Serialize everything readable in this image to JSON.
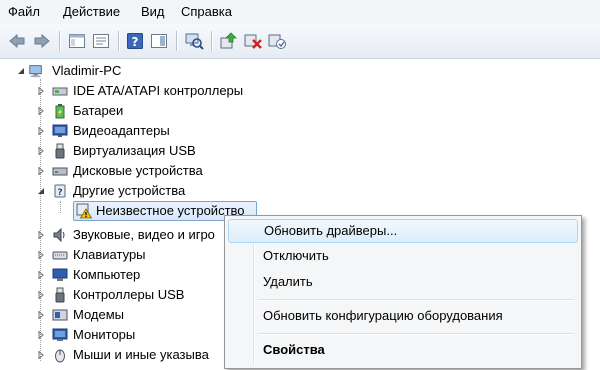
{
  "menubar": {
    "items": [
      "Файл",
      "Действие",
      "Вид",
      "Справка"
    ]
  },
  "toolbar": {
    "buttons": [
      "back-arrow-icon",
      "forward-arrow-icon",
      "show-hide-console-tree-icon",
      "properties-icon",
      "help-icon",
      "show-action-pane-icon",
      "scan-hardware-icon",
      "update-driver-icon",
      "uninstall-device-icon",
      "disable-device-icon"
    ]
  },
  "tree": {
    "root": "Vladimir-PC",
    "items": [
      {
        "label": "IDE ATA/ATAPI контроллеры",
        "icon": "ide-controller-icon"
      },
      {
        "label": "Батареи",
        "icon": "battery-icon"
      },
      {
        "label": "Видеоадаптеры",
        "icon": "display-adapter-icon"
      },
      {
        "label": "Виртуализация USB",
        "icon": "usb-virtualization-icon"
      },
      {
        "label": "Дисковые устройства",
        "icon": "disk-drive-icon"
      },
      {
        "label": "Другие устройства",
        "icon": "other-devices-icon"
      },
      {
        "label": "Неизвестное устройство",
        "icon": "unknown-device-warning-icon"
      },
      {
        "label": "Звуковые, видео и игро",
        "icon": "sound-icon"
      },
      {
        "label": "Клавиатуры",
        "icon": "keyboard-icon"
      },
      {
        "label": "Компьютер",
        "icon": "computer-icon"
      },
      {
        "label": "Контроллеры USB",
        "icon": "usb-controller-icon"
      },
      {
        "label": "Модемы",
        "icon": "modem-icon"
      },
      {
        "label": "Мониторы",
        "icon": "monitor-icon"
      },
      {
        "label": "Мыши и иные указыва",
        "icon": "mouse-icon"
      }
    ]
  },
  "context_menu": {
    "items": [
      {
        "label": "Обновить драйверы...",
        "hover": true
      },
      {
        "label": "Отключить"
      },
      {
        "label": "Удалить"
      },
      {
        "label": "Обновить конфигурацию оборудования"
      },
      {
        "label": "Свойства",
        "bold": true
      }
    ]
  },
  "colors": {
    "selection_border": "#7da2ce",
    "hover_fill": "#dcedfb",
    "menu_bg": "#f5f6f7"
  }
}
